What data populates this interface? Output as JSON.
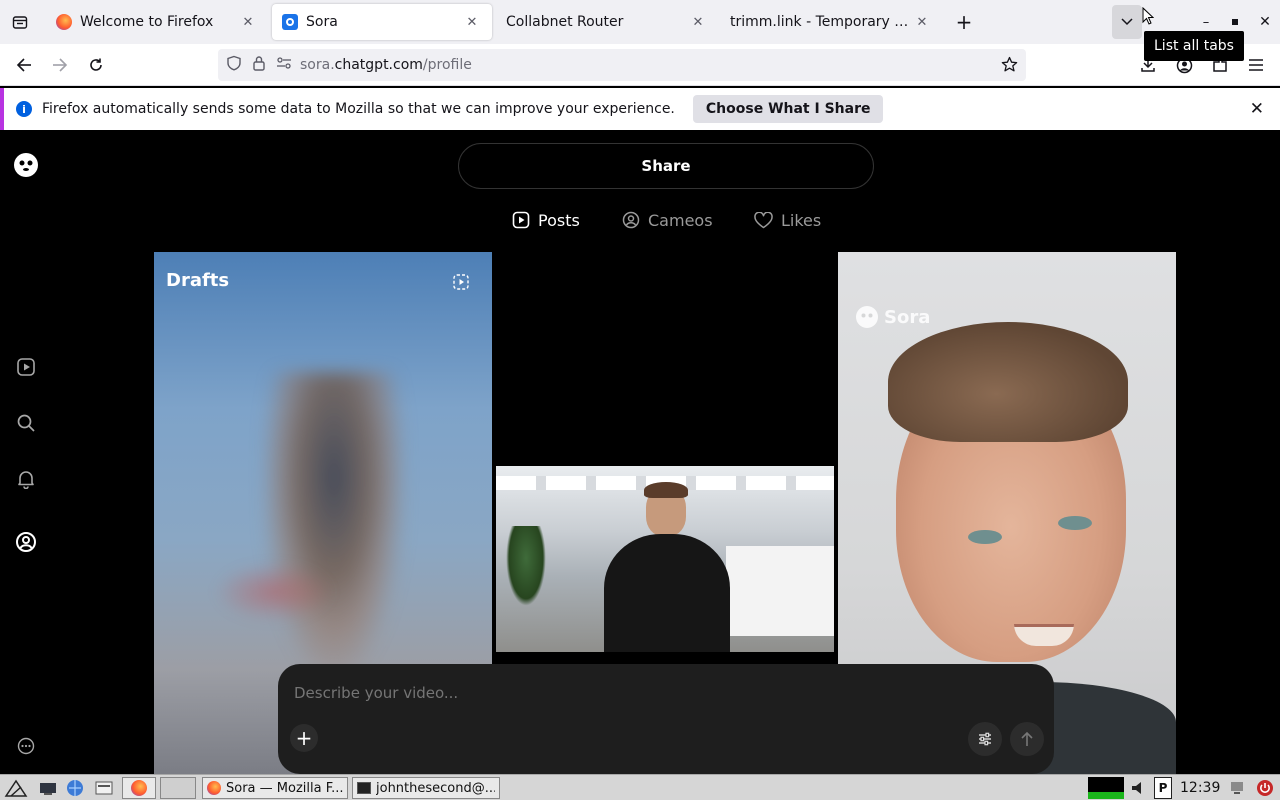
{
  "browser": {
    "tabs": [
      {
        "title": "Welcome to Firefox",
        "active": false
      },
      {
        "title": "Sora",
        "active": true
      },
      {
        "title": "Collabnet Router",
        "active": false
      },
      {
        "title": "trimm.link - Temporary URL",
        "active": false
      }
    ],
    "tooltip": "List all tabs",
    "url_domain": "sora.",
    "url_host": "chatgpt.com",
    "url_path": "/profile"
  },
  "notification": {
    "message": "Firefox automatically sends some data to Mozilla so that we can improve your experience.",
    "button": "Choose What I Share"
  },
  "sora": {
    "share_label": "Share",
    "tabs": [
      {
        "label": "Posts",
        "active": true
      },
      {
        "label": "Cameos",
        "active": false
      },
      {
        "label": "Likes",
        "active": false
      }
    ],
    "drafts_label": "Drafts",
    "watermark": "Sora",
    "composer_placeholder": "Describe your video..."
  },
  "taskbar": {
    "tasks": [
      "Sora — Mozilla F...",
      "johnthesecond@..."
    ],
    "clock": "12:39"
  },
  "colors": {
    "accent_notification": "#b833e1",
    "info_icon": "#0060df"
  }
}
